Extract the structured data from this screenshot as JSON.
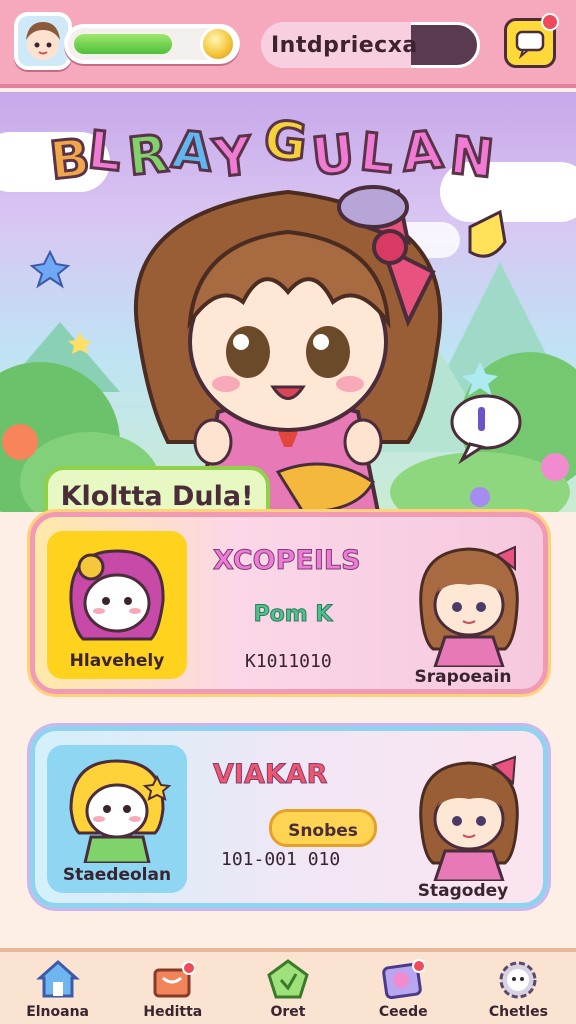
{
  "header": {
    "player_name": "Intdpriecxa",
    "xp_progress": 0.78,
    "message_badge": true
  },
  "hero": {
    "title_letters": [
      "B",
      "L",
      "R",
      "A",
      "Y",
      "G",
      "U",
      "L",
      "A",
      "N"
    ],
    "title_colors": [
      "#f2a64a",
      "#f07bd5",
      "#7fd36a",
      "#5fb6f0",
      "#f07bd5",
      "#f6d23a",
      "#f07bd5",
      "#f07bd5",
      "#f07bd5",
      "#f07bd5"
    ],
    "banner": "Kloltta Dula!"
  },
  "cards": [
    {
      "char_name": "Hlavehely",
      "title": "XCOPEILS",
      "pill": "Pom K",
      "number": "K1011010",
      "side_name": "Srapoeain"
    },
    {
      "char_name": "Staedeolan",
      "title": "VIAKAR",
      "pill": "Snobes",
      "number": "101-001 010",
      "side_name": "Stagodey"
    }
  ],
  "nav": {
    "items": [
      {
        "label": "Elnoana",
        "icon": "home-icon"
      },
      {
        "label": "Heditta",
        "icon": "shop-icon"
      },
      {
        "label": "Oret",
        "icon": "pentagon-badge-icon"
      },
      {
        "label": "Ceede",
        "icon": "gallery-icon"
      },
      {
        "label": "Chetles",
        "icon": "gear-face-icon"
      }
    ]
  },
  "colors": {
    "topbar": "#f6a9bd",
    "accent_pink": "#f19ab4",
    "accent_blue": "#8fd3ee",
    "xp_green": "#4fbf3a"
  }
}
